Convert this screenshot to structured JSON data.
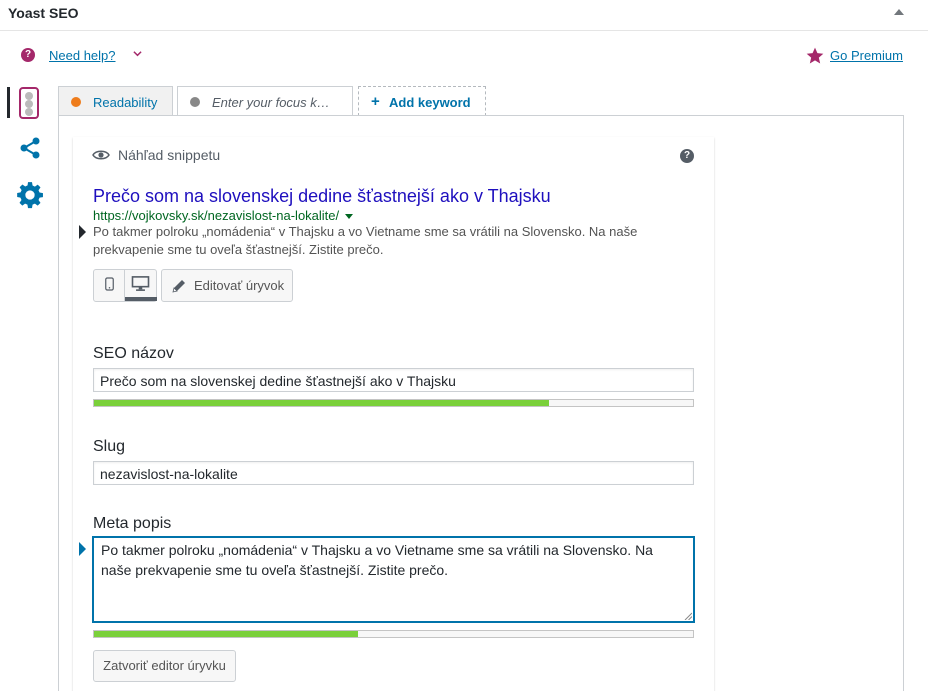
{
  "metabox": {
    "title": "Yoast SEO"
  },
  "help": {
    "need_help": "Need help?",
    "go_premium": "Go Premium"
  },
  "icons": {
    "help": "help-circle-icon",
    "premium": "star-icon",
    "share": "share-icon",
    "settings": "gear-icon",
    "preview": "eye-icon",
    "mobile": "smartphone-icon",
    "desktop": "desktop-icon",
    "edit": "pencil-icon",
    "add": "plus-icon"
  },
  "tabs": {
    "readability": {
      "label": "Readability",
      "status_color": "#ee7c1b"
    },
    "focus": {
      "label": "Enter your focus k…",
      "status_color": "#888888"
    },
    "add_keyword": {
      "plus": "+",
      "label": "Add keyword"
    }
  },
  "snippet": {
    "heading": "Náhľad snippetu",
    "help_glyph": "?",
    "serp_title": "Prečo som na slovenskej dedine šťastnejší ako v Thajsku",
    "serp_url": "https://vojkovsky.sk/nezavislost-na-lokalite/",
    "serp_description": "Po takmer polroku „nomádenia“ v Thajsku a vo Vietname sme sa vrátili na Slovensko. Na naše prekvapenie sme tu oveľa šťastnejší. Zistite prečo.",
    "edit_button": "Editovať úryvok",
    "preview_mode": "desktop"
  },
  "fields": {
    "seo_title": {
      "label": "SEO názov",
      "value": "Prečo som na slovenskej dedine šťastnejší ako v Thajsku",
      "progress": 0.76,
      "progress_color": "#7ad03a"
    },
    "slug": {
      "label": "Slug",
      "value": "nezavislost-na-lokalite"
    },
    "meta_description": {
      "label": "Meta popis",
      "value": "Po takmer polroku „nomádenia“ v Thajsku a vo Vietname sme sa vrátili na Slovensko. Na naše prekvapenie sme tu oveľa šťastnejší. Zistite prečo.",
      "progress": 0.44,
      "progress_color": "#7ad03a"
    }
  },
  "close_editor_button": "Zatvoriť editor úryvku",
  "colors": {
    "link": "#0073aa",
    "brand": "#a4286a",
    "serp_title": "#1e0fbe",
    "serp_url": "#006621"
  }
}
